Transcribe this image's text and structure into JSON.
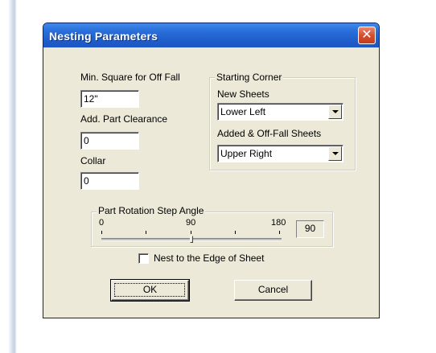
{
  "dialog": {
    "title": "Nesting Parameters",
    "close_glyph": "✕"
  },
  "fields": {
    "min_square_label": "Min. Square for Off Fall",
    "min_square_value": "12\"",
    "clearance_label": "Add. Part Clearance",
    "clearance_value": "0",
    "collar_label": "Collar",
    "collar_value": "0"
  },
  "starting_corner": {
    "legend": "Starting Corner",
    "new_sheets_label": "New Sheets",
    "new_sheets_value": "Lower Left",
    "added_label": "Added & Off-Fall Sheets",
    "added_value": "Upper Right"
  },
  "rotation": {
    "legend": "Part Rotation Step Angle",
    "tick_min": "0",
    "tick_mid": "90",
    "tick_max": "180",
    "value": "90",
    "slider_fraction": 0.5
  },
  "nest_edge": {
    "label": "Nest to the Edge of Sheet",
    "checked": false
  },
  "buttons": {
    "ok": "OK",
    "cancel": "Cancel"
  },
  "colors": {
    "titlebar": "#2a6fdb",
    "dialog_bg": "#ece9d8",
    "close": "#d4502f"
  }
}
